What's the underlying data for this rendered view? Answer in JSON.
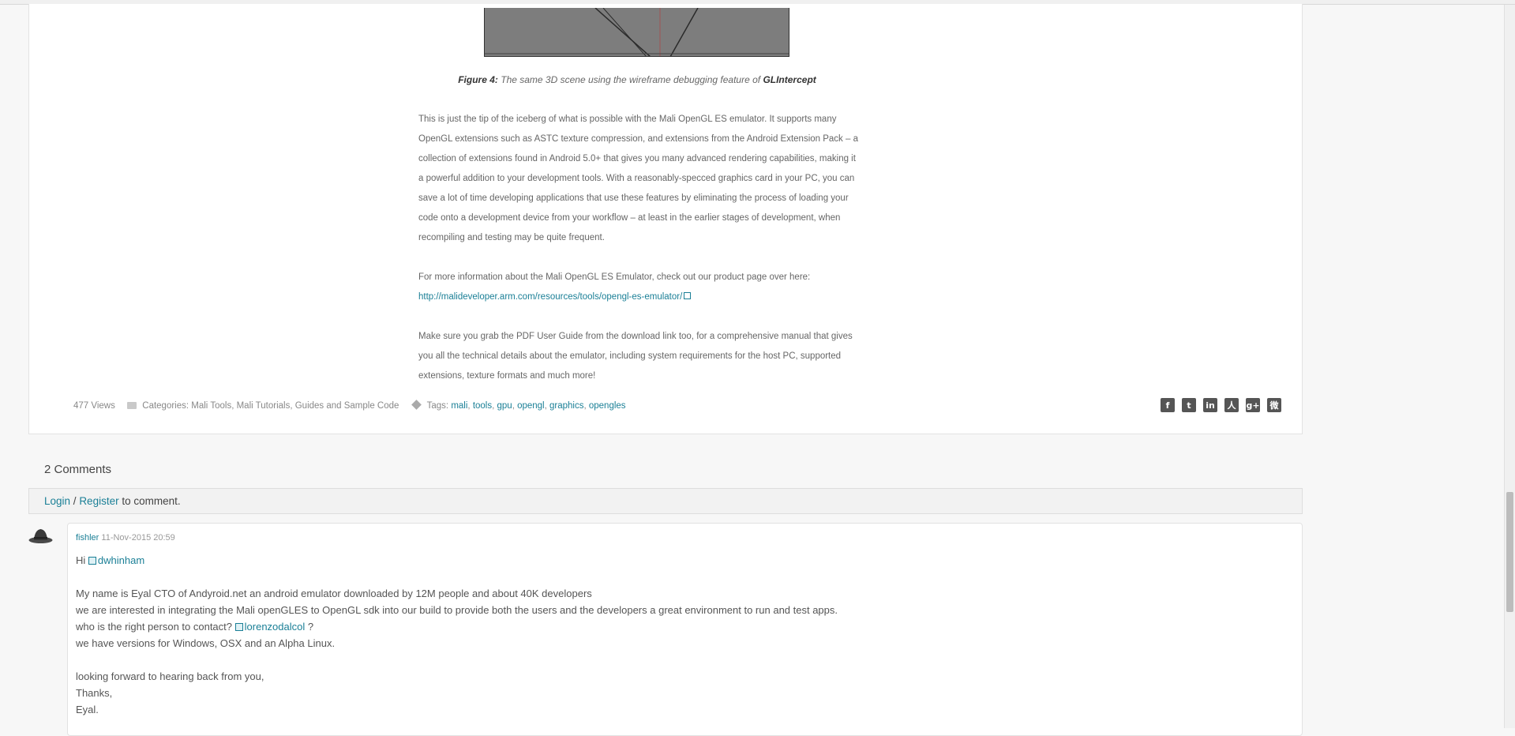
{
  "figure": {
    "label": "Figure 4:",
    "caption": "The same 3D scene using the wireframe debugging feature of",
    "tool": "GLIntercept"
  },
  "article": {
    "p1": "This is just the tip of the iceberg of what is possible with the Mali OpenGL ES emulator. It supports many OpenGL extensions such as ASTC texture compression, and extensions from the Android Extension Pack – a collection of extensions found in Android 5.0+ that gives you many advanced rendering capabilities, making it a powerful addition to your development tools. With a reasonably-specced graphics card in your PC, you can save a lot of time developing applications that use these features by eliminating the process of loading your code onto a development device from your workflow – at least in the earlier stages of development, when recompiling and testing may be quite frequent.",
    "p2": "For more information about the Mali OpenGL ES Emulator, check out our product page over here:",
    "p2_link": "http://malideveloper.arm.com/resources/tools/opengl-es-emulator/",
    "p3": "Make sure you grab the PDF User Guide from the download link too, for a comprehensive manual that gives you all the technical details about the emulator, including system requirements for the host PC, supported extensions, texture formats and much more!"
  },
  "meta": {
    "views": "477 Views",
    "categories_label": "Categories:",
    "categories": "Mali Tools, Mali Tutorials, Guides and Sample Code",
    "tags_label": "Tags:",
    "tags": [
      "mali",
      "tools",
      "gpu",
      "opengl",
      "graphics",
      "opengles"
    ]
  },
  "social": [
    {
      "name": "facebook-icon",
      "glyph": "f"
    },
    {
      "name": "twitter-icon",
      "glyph": "t"
    },
    {
      "name": "linkedin-icon",
      "glyph": "in"
    },
    {
      "name": "renren-icon",
      "glyph": "人"
    },
    {
      "name": "google-plus-icon",
      "glyph": "g+"
    },
    {
      "name": "weibo-icon",
      "glyph": "微"
    }
  ],
  "comments": {
    "count": "2 Comments",
    "login": "Login",
    "separator": " / ",
    "register": "Register",
    "to_comment": " to comment.",
    "items": [
      {
        "author": "fishler",
        "date": "11-Nov-2015 20:59",
        "greeting": "Hi",
        "mention": "dwhinham",
        "line1": "My name is Eyal CTO of Andyroid.net an android emulator downloaded by 12M people and about 40K developers",
        "line2": "we are interested in integrating the Mali openGLES to OpenGL sdk into our build to provide both the users and the developers a great environment to run and test apps.",
        "line3": "who is the right person to contact?",
        "mention2": "lorenzodalcol",
        "line3_end": " ?",
        "line4": "we have versions for Windows, OSX and an Alpha Linux.",
        "line5": "looking forward to hearing back from you,",
        "line6": "Thanks,",
        "line7": "Eyal."
      }
    ]
  }
}
